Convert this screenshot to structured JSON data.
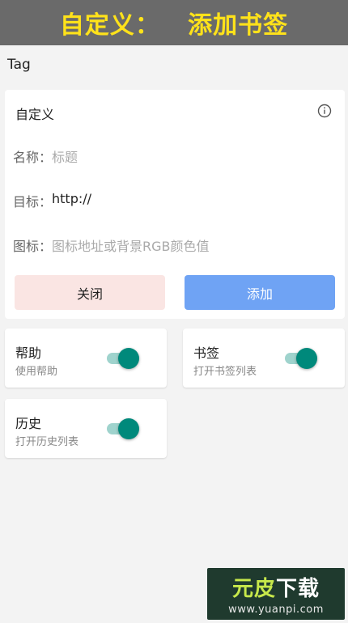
{
  "banner": {
    "title": "自定义：   添加书签"
  },
  "section": {
    "label": "Tag"
  },
  "form": {
    "title": "自定义",
    "name_label": "名称：",
    "name_placeholder": "标题",
    "target_label": "目标：",
    "target_value": "http://",
    "icon_label": "图标：",
    "icon_placeholder": "图标地址或背景RGB颜色值",
    "close_button": "关闭",
    "add_button": "添加"
  },
  "toggles": [
    {
      "title": "帮助",
      "subtitle": "使用帮助",
      "enabled": true
    },
    {
      "title": "书签",
      "subtitle": "打开书签列表",
      "enabled": true
    },
    {
      "title": "历史",
      "subtitle": "打开历史列表",
      "enabled": true
    }
  ],
  "watermark": {
    "brand_a": "元皮",
    "brand_b": "下载",
    "url": "www.yuanpi.com"
  },
  "colors": {
    "accent": "#00897b",
    "track": "#9fd3cd",
    "add_button": "#6fa3f4",
    "close_button": "#fae5e3",
    "banner_text": "#ffe21a"
  }
}
